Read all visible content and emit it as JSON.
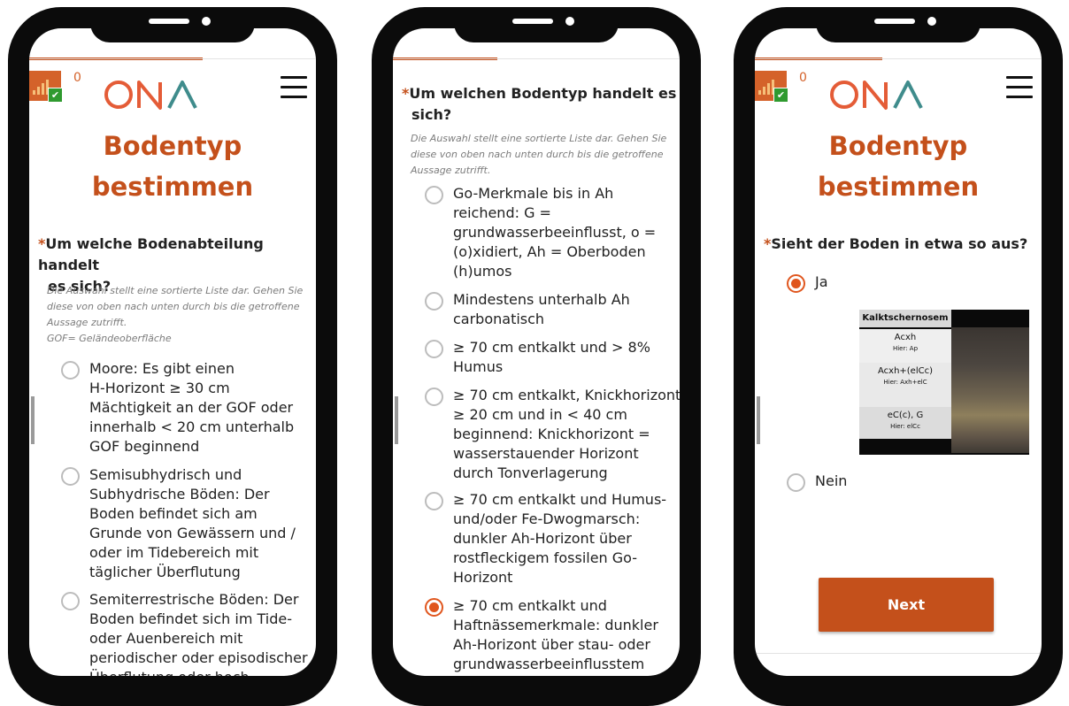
{
  "brand": {
    "primary": "#c4501b",
    "radio_accent": "#e0561e",
    "badge": "#d4622a",
    "badge_check": "#2f9a2f",
    "logo_orange": "#e45c37",
    "logo_teal": "#3f8c8c"
  },
  "phones": [
    {
      "header": {
        "badge_count": "0",
        "logo_alt": "ONA",
        "menu_icon": "hamburger-icon"
      },
      "title_line1": "Bodentyp",
      "title_line2": "bestimmen",
      "question": {
        "asterisk": "*",
        "line1": "Um welche Bodenabteilung handelt",
        "line2": "es sich?",
        "hint_lines": [
          "Die Auswahl stellt eine sortierte Liste dar. Gehen Sie",
          "diese von oben nach unten durch bis die getroffene",
          "Aussage zutrifft.",
          "GOF= Geländeoberfläche"
        ]
      },
      "options": [
        {
          "selected": false,
          "lines": [
            "Moore: Es gibt einen",
            "H-Horizont ≥ 30 cm",
            "Mächtigkeit an der GOF oder",
            "innerhalb < 20 cm unterhalb",
            "GOF beginnend"
          ]
        },
        {
          "selected": false,
          "lines": [
            "Semisubhydrisch und",
            "Subhydrische Böden: Der",
            "Boden befindet sich am",
            "Grunde von Gewässern und /",
            "oder im Tidebereich mit",
            "täglicher Überflutung"
          ]
        },
        {
          "selected": false,
          "lines": [
            "Semiterrestrische Böden: Der",
            "Boden befindet sich im Tide-",
            "oder Auenbereich mit",
            "periodischer oder episodischer",
            "Überflutung oder hoch"
          ]
        }
      ]
    },
    {
      "question": {
        "asterisk": "*",
        "line1": "Um welchen Bodentyp handelt es",
        "line2": "sich?",
        "hint_lines": [
          "Die Auswahl stellt eine sortierte Liste dar. Gehen Sie",
          "diese von oben nach unten durch bis die getroffene",
          "Aussage zutrifft."
        ]
      },
      "options": [
        {
          "selected": false,
          "lines": [
            "Go-Merkmale bis in Ah",
            "reichend: G =",
            "grundwasserbeeinflusst, o =",
            "(o)xidiert, Ah = Oberboden",
            "(h)umos"
          ]
        },
        {
          "selected": false,
          "lines": [
            "Mindestens unterhalb Ah",
            "carbonatisch"
          ]
        },
        {
          "selected": false,
          "lines": [
            "≥ 70 cm entkalkt und > 8%",
            "Humus"
          ]
        },
        {
          "selected": false,
          "lines": [
            "≥ 70 cm entkalkt, Knickhorizont",
            "≥ 20 cm und in < 40 cm",
            "beginnend: Knickhorizont =",
            "wasserstauender Horizont",
            "durch Tonverlagerung"
          ]
        },
        {
          "selected": false,
          "lines": [
            "≥ 70 cm entkalkt und Humus-",
            "und/oder Fe-Dwogmarsch:",
            "dunkler Ah-Horizont über",
            "rostfleckigem fossilen Go-",
            "Horizont"
          ]
        },
        {
          "selected": true,
          "lines": [
            "≥ 70 cm entkalkt und",
            "Haftnässemerkmale: dunkler",
            "Ah-Horizont über stau- oder",
            "grundwasserbeeinflusstem"
          ]
        }
      ]
    },
    {
      "header": {
        "badge_count": "0",
        "logo_alt": "ONA",
        "menu_icon": "hamburger-icon"
      },
      "title_line1": "Bodentyp",
      "title_line2": "bestimmen",
      "question": {
        "asterisk": "*",
        "line1": "Sieht der Boden in etwa so aus?"
      },
      "options": [
        {
          "selected": true,
          "label": "Ja"
        },
        {
          "selected": false,
          "label": "Nein"
        }
      ],
      "reference_image": {
        "title": "Kalktschernosem",
        "layers": [
          {
            "name": "Acxh",
            "sub": "Hier: Ap"
          },
          {
            "name": "Acxh+(elCc)",
            "sub": "Hier: Axh+elC"
          },
          {
            "name": "eC(c), G",
            "sub": "Hier: elCc"
          }
        ]
      },
      "next_label": "Next"
    }
  ]
}
